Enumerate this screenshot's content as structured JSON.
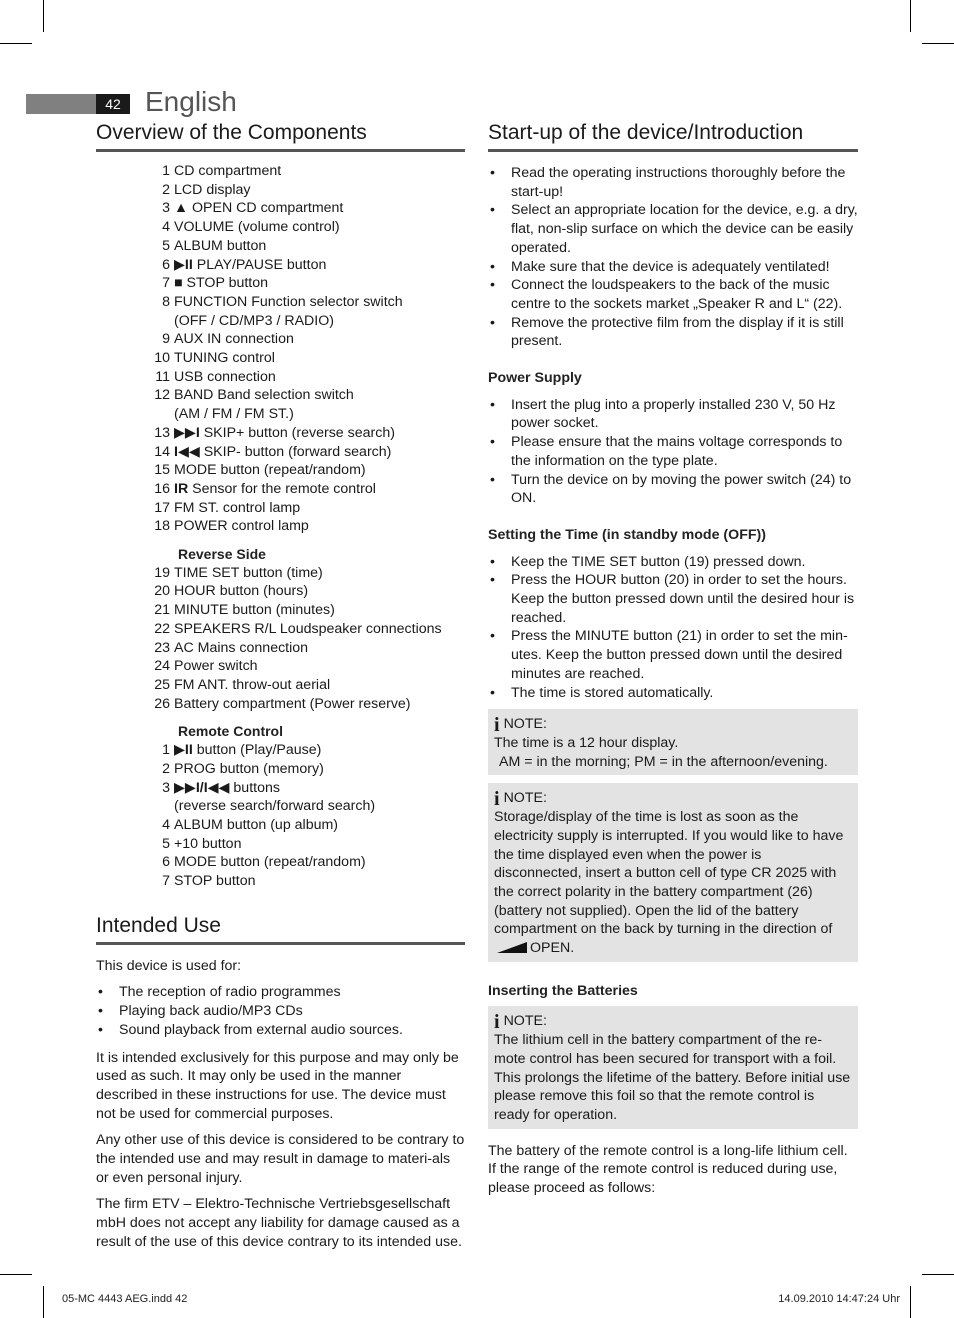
{
  "header": {
    "page_number": "42",
    "language": "English"
  },
  "components": {
    "title": "Overview of the Components",
    "items": [
      {
        "num": "1",
        "glyph": "",
        "text": "CD compartment"
      },
      {
        "num": "2",
        "glyph": "",
        "text": "LCD display"
      },
      {
        "num": "3",
        "glyph": "▲",
        "text": "OPEN  CD compartment"
      },
      {
        "num": "4",
        "glyph": "",
        "text": "VOLUME (volume control)"
      },
      {
        "num": "5",
        "glyph": "",
        "text": "ALBUM button"
      },
      {
        "num": "6",
        "glyph": "▶II",
        "text": "PLAY/PAUSE button"
      },
      {
        "num": "7",
        "glyph": "■",
        "text": "STOP button"
      },
      {
        "num": "8",
        "glyph": "",
        "text": "FUNCTION Function selector switch"
      },
      {
        "num": "",
        "glyph": "",
        "text": "(OFF / CD/MP3 / RADIO)"
      },
      {
        "num": "9",
        "glyph": "",
        "text": "AUX IN connection"
      },
      {
        "num": "10",
        "glyph": "",
        "text": "TUNING control"
      },
      {
        "num": "11",
        "glyph": "",
        "text": "USB connection"
      },
      {
        "num": "12",
        "glyph": "",
        "text": "BAND Band selection switch"
      },
      {
        "num": "",
        "glyph": "",
        "text": "(AM / FM / FM ST.)"
      },
      {
        "num": "13",
        "glyph": "▶▶I",
        "text": "SKIP+ button (reverse search)"
      },
      {
        "num": "14",
        "glyph": "I◀◀",
        "text": "SKIP- button (forward search)"
      },
      {
        "num": "15",
        "glyph": "",
        "text": "MODE button (repeat/random)"
      },
      {
        "num": "16",
        "glyph": "IR",
        "text": "Sensor for the remote control"
      },
      {
        "num": "17",
        "glyph": "",
        "text": "FM ST. control lamp"
      },
      {
        "num": "18",
        "glyph": "",
        "text": "POWER control lamp"
      }
    ],
    "reverse_title": "Reverse Side",
    "reverse_items": [
      {
        "num": "19",
        "text": "TIME SET button (time)"
      },
      {
        "num": "20",
        "text": "HOUR button (hours)"
      },
      {
        "num": "21",
        "text": "MINUTE button (minutes)"
      },
      {
        "num": "22",
        "text": "SPEAKERS R/L Loudspeaker connections"
      },
      {
        "num": "23",
        "text": "AC Mains connection"
      },
      {
        "num": "24",
        "text": "Power switch"
      },
      {
        "num": "25",
        "text": "FM ANT. throw-out aerial"
      },
      {
        "num": "26",
        "text": "Battery compartment (Power reserve)"
      }
    ],
    "remote_title": "Remote Control",
    "remote_items": [
      {
        "num": "1",
        "glyph": "▶II",
        "text": "button (Play/Pause)"
      },
      {
        "num": "2",
        "glyph": "",
        "text": "PROG button (memory)"
      },
      {
        "num": "3",
        "glyph": "▶▶I/I◀◀",
        "text": "buttons"
      },
      {
        "num": "",
        "glyph": "",
        "text": "(reverse search/forward search)"
      },
      {
        "num": "4",
        "glyph": "",
        "text": "ALBUM button (up album)"
      },
      {
        "num": "5",
        "glyph": "",
        "text": "+10 button"
      },
      {
        "num": "6",
        "glyph": "",
        "text": "MODE button (repeat/random)"
      },
      {
        "num": "7",
        "glyph": "",
        "text": "STOP button"
      }
    ]
  },
  "intended_use": {
    "title": "Intended Use",
    "intro": "This device is used for:",
    "bullets": [
      "The reception of radio programmes",
      "Playing back audio/MP3 CDs",
      "Sound playback from external audio sources."
    ],
    "paragraphs": [
      "It is intended exclusively for this purpose and may only be used as such. It may only be used in the manner described in these instructions for use. The device must not be used for commercial purposes.",
      "Any other use of this device is considered to be contrary to the intended use and may result in damage to materi-als or even personal injury.",
      "The firm ETV – Elektro-Technische Vertriebsgesellschaft mbH does not accept any liability for damage caused as a result of the use of this device contrary to its intended use."
    ]
  },
  "startup": {
    "title": "Start-up of the device/Introduction",
    "bullets": [
      "Read the operating instructions thoroughly before the start-up!",
      "Select an appropriate location for the device, e.g. a dry, flat, non-slip surface on which the device can be easily operated.",
      "Make sure that the device is adequately ventilated!",
      "Connect the loudspeakers to the back of the music centre to the sockets market „Speaker R and L“ (22).",
      "Remove the protective film from the display if it is still present."
    ],
    "power_supply": {
      "title": "Power Supply",
      "bullets": [
        "Insert the plug into a properly installed 230 V, 50 Hz power socket.",
        "Please ensure that the mains voltage corresponds to the information on the type plate.",
        "Turn the device on by moving the power switch (24) to ON."
      ]
    },
    "setting_time": {
      "title": "Setting the Time (in standby mode (OFF))",
      "bullets": [
        "Keep the TIME SET button (19) pressed down.",
        "Press the HOUR button (20) in order to set the hours. Keep the button pressed down until the desired hour is reached.",
        "Press the MINUTE button (21) in order to set the min-utes. Keep the button pressed down until the desired minutes are reached.",
        "The time is stored automatically."
      ]
    },
    "note1": {
      "label": "NOTE:",
      "line1": "The time is a 12 hour display.",
      "line2": "AM = in the morning; PM = in the afternoon/evening."
    },
    "note2": {
      "label": "NOTE:",
      "text": "Storage/display of the time is lost as soon as the electricity supply is interrupted. If you would like to have the time displayed even when the power is disconnected, insert a button cell of type CR 2025 with the correct polarity in the battery compartment (26) (battery not supplied). Open the lid of the battery compartment on the back by turning in the direction of",
      "text_end": "OPEN."
    },
    "batteries": {
      "title": "Inserting the Batteries",
      "note_label": "NOTE:",
      "note_text": "The lithium cell in the battery compartment of the re-mote control has been secured for transport with a foil. This prolongs the lifetime of the battery. Before initial use please remove this foil so that the remote control is ready for operation.",
      "paragraph": "The battery of the remote control is a long-life lithium cell. If the range of the remote control is reduced during use, please proceed as follows:"
    }
  },
  "footer": {
    "file": "05-MC 4443 AEG.indd   42",
    "timestamp": "14.09.2010   14:47:24 Uhr"
  }
}
